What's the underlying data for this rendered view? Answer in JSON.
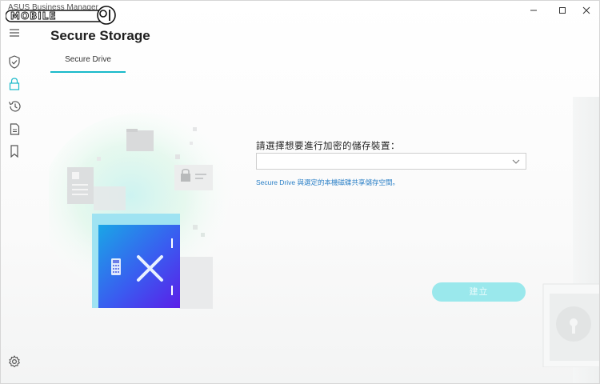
{
  "window": {
    "app_title": "ASUS Business Manager",
    "watermark_text": "MOBILE01",
    "controls": {
      "minimize": "—",
      "maximize": "☐",
      "close": "✕"
    }
  },
  "nav": {
    "items": [
      {
        "icon": "menu-icon"
      },
      {
        "icon": "shield-check-icon"
      },
      {
        "icon": "lock-icon",
        "active": true
      },
      {
        "icon": "history-icon"
      },
      {
        "icon": "document-icon"
      },
      {
        "icon": "bookmark-icon"
      },
      {
        "icon": "settings-gear-icon"
      }
    ],
    "active_color": "#19b9c9"
  },
  "page": {
    "title": "Secure Storage",
    "tabs": [
      {
        "label": "Secure Drive",
        "active": true
      }
    ]
  },
  "form": {
    "label": "請選擇想要進行加密的儲存裝置：",
    "select_value": "",
    "hint": "Secure Drive 與選定的本機磁碟共享儲存空間。",
    "create_button": "建立"
  },
  "colors": {
    "accent": "#19b9c9",
    "button_disabled": "#9ae8ec",
    "hint": "#2a7fc6"
  }
}
